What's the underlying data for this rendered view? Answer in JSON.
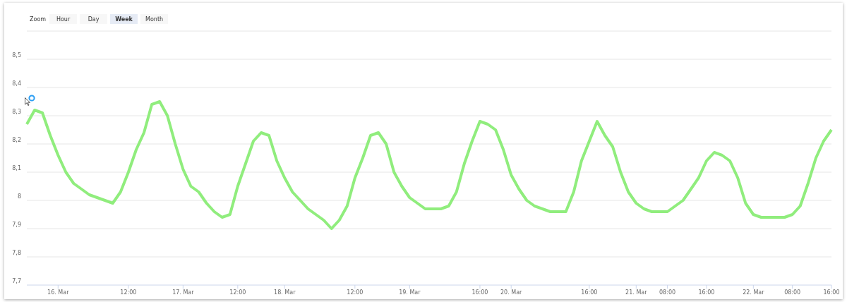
{
  "zoom": {
    "label": "Zoom",
    "buttons": [
      {
        "label": "Hour",
        "selected": false
      },
      {
        "label": "Day",
        "selected": false
      },
      {
        "label": "Week",
        "selected": true
      },
      {
        "label": "Month",
        "selected": false
      }
    ]
  },
  "chart_data": {
    "type": "line",
    "grid": true,
    "ylim": [
      7.7,
      8.6
    ],
    "yticks": [
      {
        "value": 7.7,
        "label": "7,7"
      },
      {
        "value": 7.8,
        "label": "7,8"
      },
      {
        "value": 7.9,
        "label": "7,9"
      },
      {
        "value": 8,
        "label": "8"
      },
      {
        "value": 8.1,
        "label": "8,1"
      },
      {
        "value": 8.2,
        "label": "8,2"
      },
      {
        "value": 8.3,
        "label": "8,3"
      },
      {
        "value": 8.4,
        "label": "8,4"
      },
      {
        "value": 8.5,
        "label": "8,5"
      }
    ],
    "categories": [
      null,
      null,
      null,
      null,
      "16. Mar",
      null,
      null,
      null,
      null,
      null,
      null,
      null,
      null,
      "12:00",
      null,
      null,
      null,
      null,
      null,
      null,
      "17. Mar",
      null,
      null,
      null,
      null,
      null,
      null,
      "12:00",
      null,
      null,
      null,
      null,
      null,
      "18. Mar",
      null,
      null,
      null,
      null,
      null,
      null,
      null,
      null,
      "12:00",
      null,
      null,
      null,
      null,
      null,
      null,
      "19. Mar",
      null,
      null,
      null,
      null,
      null,
      null,
      null,
      null,
      "16:00",
      null,
      null,
      null,
      "20. Mar",
      null,
      null,
      null,
      null,
      null,
      null,
      null,
      null,
      null,
      "16:00",
      null,
      null,
      null,
      null,
      null,
      "21. Mar",
      null,
      null,
      null,
      "08:00",
      null,
      null,
      null,
      null,
      "16:00",
      null,
      null,
      null,
      null,
      null,
      "22. Mar",
      null,
      null,
      null,
      null,
      "08:00",
      null,
      null,
      null,
      null,
      "16:00"
    ],
    "series": [
      {
        "color": "#90ed7d",
        "values": [
          8.27,
          8.32,
          8.31,
          8.23,
          8.16,
          8.1,
          8.06,
          8.04,
          8.02,
          8.01,
          8.0,
          7.99,
          8.03,
          8.1,
          8.18,
          8.24,
          8.34,
          8.35,
          8.3,
          8.2,
          8.11,
          8.05,
          8.03,
          7.99,
          7.96,
          7.94,
          7.95,
          8.05,
          8.13,
          8.21,
          8.24,
          8.23,
          8.14,
          8.08,
          8.03,
          8.0,
          7.97,
          7.95,
          7.93,
          7.9,
          7.93,
          7.98,
          8.08,
          8.15,
          8.23,
          8.24,
          8.2,
          8.1,
          8.05,
          8.01,
          7.99,
          7.97,
          7.97,
          7.97,
          7.98,
          8.03,
          8.13,
          8.21,
          8.28,
          8.27,
          8.25,
          8.18,
          8.09,
          8.04,
          8.0,
          7.98,
          7.97,
          7.96,
          7.96,
          7.96,
          8.03,
          8.14,
          8.21,
          8.28,
          8.23,
          8.19,
          8.1,
          8.03,
          7.99,
          7.97,
          7.96,
          7.96,
          7.96,
          7.98,
          8.0,
          8.04,
          8.08,
          8.14,
          8.17,
          8.16,
          8.14,
          8.08,
          7.99,
          7.95,
          7.94,
          7.94,
          7.94,
          7.94,
          7.95,
          7.98,
          8.06,
          8.15,
          8.21,
          8.25
        ]
      }
    ]
  }
}
